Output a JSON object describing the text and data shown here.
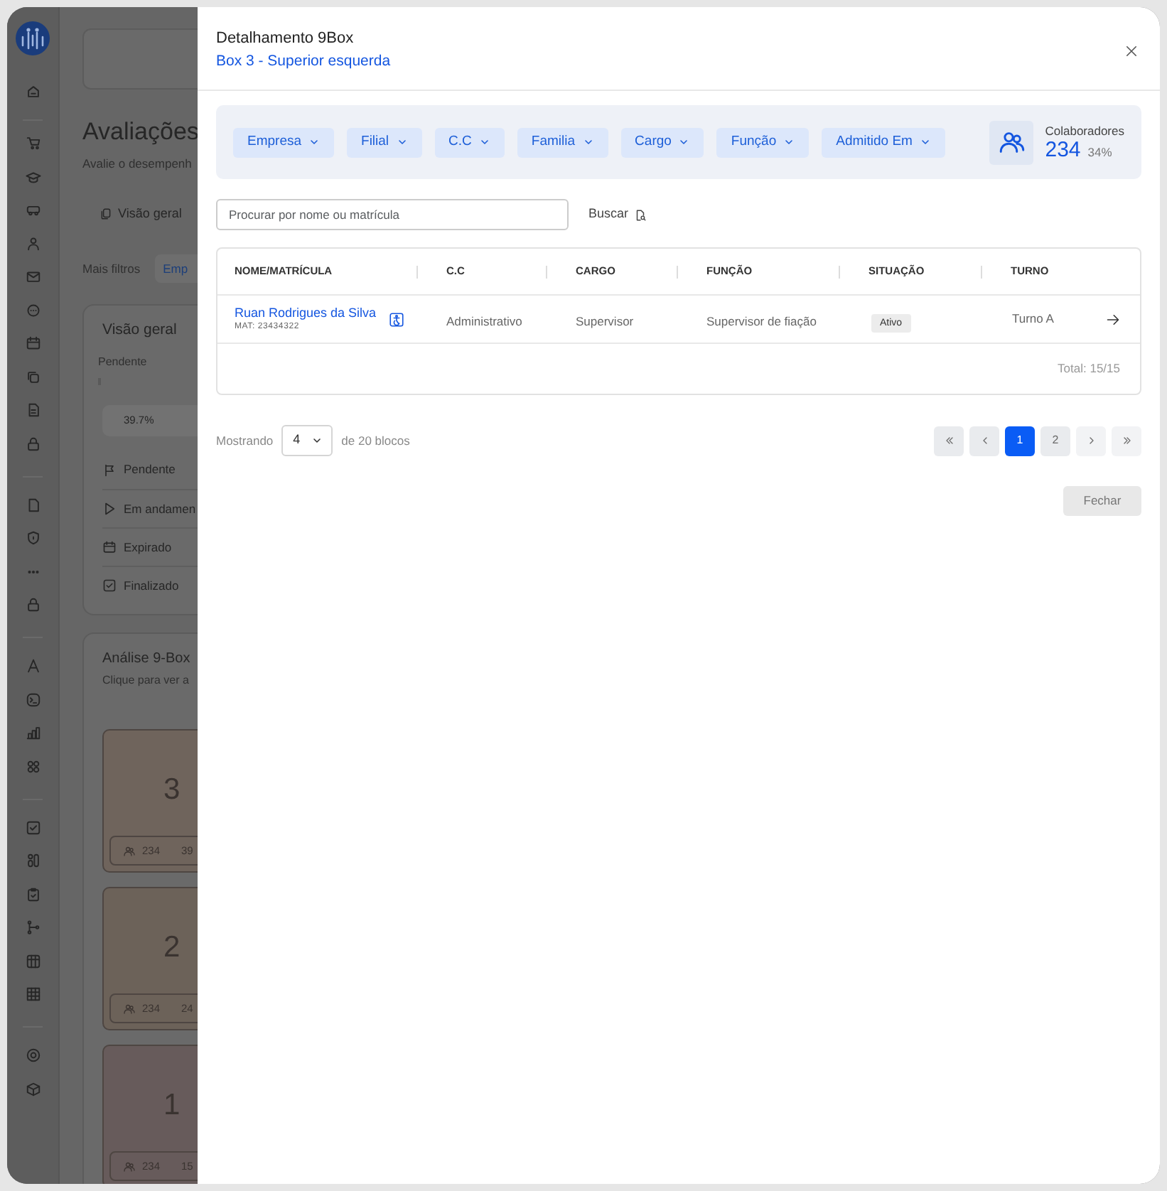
{
  "background_page": {
    "title": "Avaliações",
    "subtitle": "Avalie o desempenh",
    "tab": "Visão geral",
    "filters_label": "Mais filtros",
    "filter_chip": "Emp",
    "overview": {
      "title": "Visão geral",
      "legend": "Pendente",
      "progress_label": "39.7%",
      "statuses": [
        {
          "label": "Pendente",
          "kind": "flag"
        },
        {
          "label": "Em andamen",
          "kind": "play"
        },
        {
          "label": "Expirado",
          "kind": "calendar"
        },
        {
          "label": "Finalizado",
          "kind": "check"
        }
      ]
    },
    "ninebox": {
      "title": "Análise 9-Box",
      "subtitle": "Clique para ver a",
      "boxes": [
        {
          "number": "3",
          "count": "234",
          "percent": "39",
          "color": "#6f645c"
        },
        {
          "number": "2",
          "count": "234",
          "percent": "24",
          "color": "#6c6259"
        },
        {
          "number": "1",
          "count": "234",
          "percent": "15",
          "color": "#675b5b"
        }
      ]
    }
  },
  "drawer": {
    "title": "Detalhamento 9Box",
    "subtitle": "Box 3 - Superior esquerda",
    "filters": [
      "Empresa",
      "Filial",
      "C.C",
      "Familia",
      "Cargo",
      "Função",
      "Admitido Em"
    ],
    "summary": {
      "label": "Colaboradores",
      "count": "234",
      "percent": "34%"
    },
    "search": {
      "placeholder": "Procurar por nome ou matrícula",
      "button": "Buscar"
    },
    "table": {
      "columns": [
        "NOME/MATRÍCULA",
        "C.C",
        "CARGO",
        "FUNÇÃO",
        "SITUAÇÃO",
        "TURNO"
      ],
      "rows": [
        {
          "name": "Ruan Rodrigues da Silva",
          "registration": "MAT: 23434322",
          "cost_center": "Administrativo",
          "role": "Supervisor",
          "function": "Supervisor de fiação",
          "status": "Ativo",
          "shift": "Turno A"
        }
      ],
      "total": "Total: 15/15"
    },
    "pagination": {
      "showing_label": "Mostrando",
      "page_size": "4",
      "of_label": "de 20 blocos",
      "pages": [
        {
          "label": "1",
          "selected": true
        },
        {
          "label": "2",
          "selected": false
        }
      ]
    },
    "close_button": "Fechar"
  }
}
